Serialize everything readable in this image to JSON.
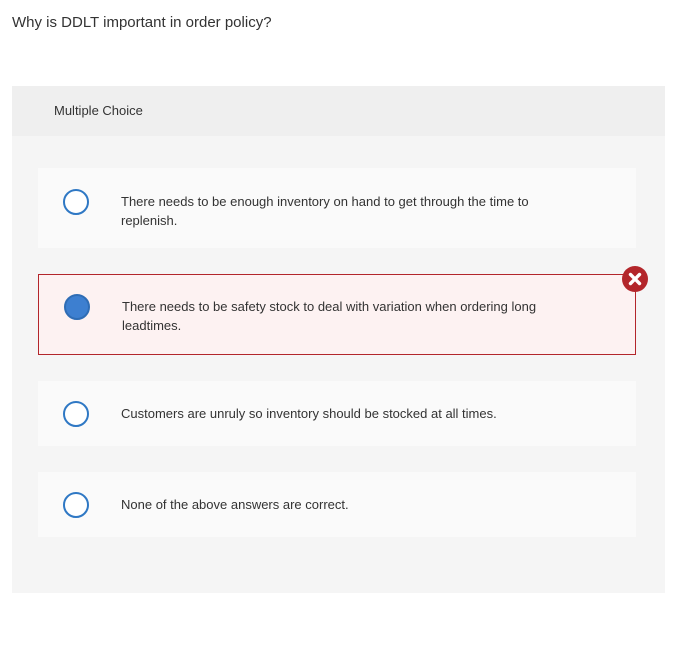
{
  "question": {
    "text": "Why is DDLT important in order policy?"
  },
  "panel": {
    "header_label": "Multiple Choice",
    "options": [
      {
        "text": "There needs to be enough inventory on hand to get through the time to replenish.",
        "selected": false
      },
      {
        "text": "There needs to be safety stock to deal with variation when ordering long leadtimes.",
        "selected": true,
        "status": "incorrect"
      },
      {
        "text": "Customers are unruly so inventory should be stocked at all times.",
        "selected": false
      },
      {
        "text": "None of the above answers are correct.",
        "selected": false
      }
    ]
  },
  "colors": {
    "radio_border": "#2f78c4",
    "radio_fill": "#3d7fd0",
    "incorrect": "#b3262b",
    "incorrect_bg": "#fdf2f2"
  },
  "icons": {
    "incorrect_marker": "x-circle-icon"
  }
}
